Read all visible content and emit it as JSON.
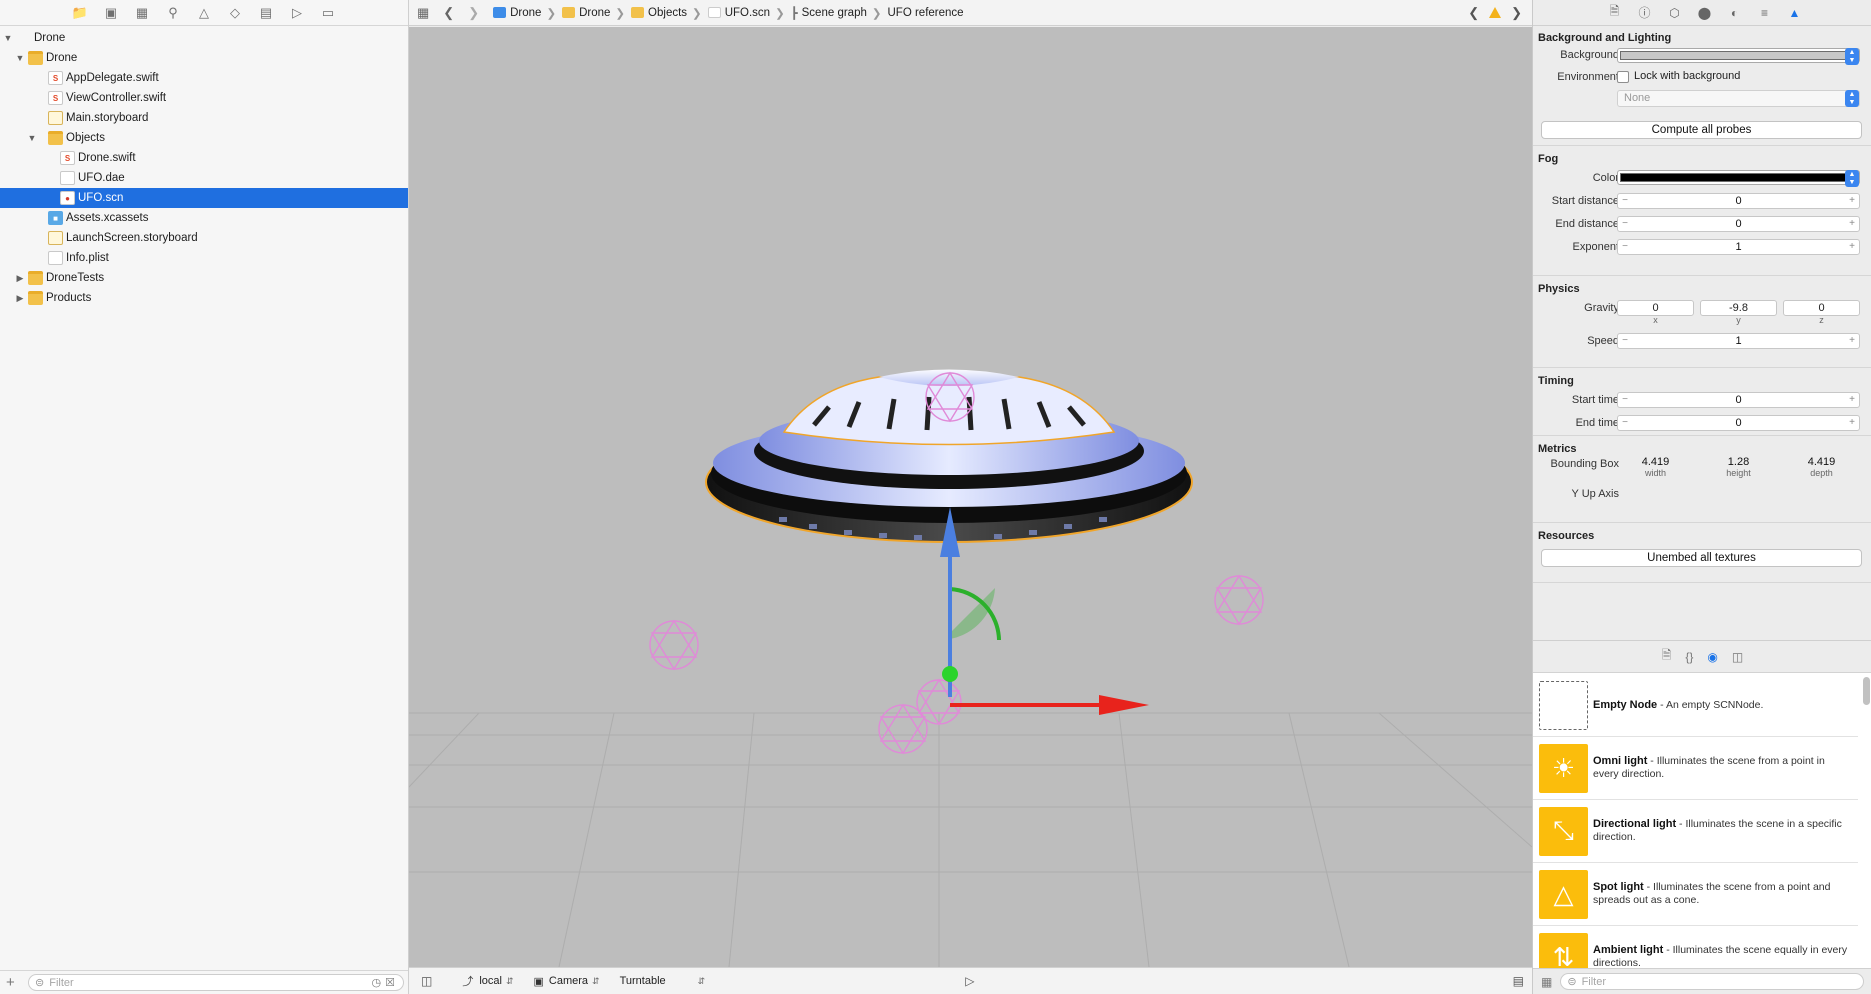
{
  "navigator": {
    "toolbar_icons": [
      "folder-icon",
      "source-control-icon",
      "symbol-icon",
      "search-icon",
      "issue-icon",
      "test-icon",
      "debug-icon",
      "breakpoint-icon",
      "report-icon"
    ],
    "tree": [
      {
        "label": "Drone",
        "icon": "project",
        "depth": 0,
        "disclosure": "open"
      },
      {
        "label": "Drone",
        "icon": "folder",
        "depth": 1,
        "disclosure": "open"
      },
      {
        "label": "AppDelegate.swift",
        "icon": "swift",
        "depth": 2,
        "disclosure": ""
      },
      {
        "label": "ViewController.swift",
        "icon": "swift",
        "depth": 2,
        "disclosure": ""
      },
      {
        "label": "Main.storyboard",
        "icon": "sb",
        "depth": 2,
        "disclosure": ""
      },
      {
        "label": "Objects",
        "icon": "folder",
        "depth": 2,
        "disclosure": "open"
      },
      {
        "label": "Drone.swift",
        "icon": "swift",
        "depth": 3,
        "disclosure": ""
      },
      {
        "label": "UFO.dae",
        "icon": "dae",
        "depth": 3,
        "disclosure": ""
      },
      {
        "label": "UFO.scn",
        "icon": "scn",
        "depth": 3,
        "disclosure": "",
        "selected": true
      },
      {
        "label": "Assets.xcassets",
        "icon": "assets",
        "depth": 2,
        "disclosure": ""
      },
      {
        "label": "LaunchScreen.storyboard",
        "icon": "sb",
        "depth": 2,
        "disclosure": ""
      },
      {
        "label": "Info.plist",
        "icon": "plist",
        "depth": 2,
        "disclosure": ""
      },
      {
        "label": "DroneTests",
        "icon": "folder",
        "depth": 1,
        "disclosure": "closed"
      },
      {
        "label": "Products",
        "icon": "folder",
        "depth": 1,
        "disclosure": "closed"
      }
    ],
    "filter_placeholder": "Filter"
  },
  "jumpbar": {
    "crumbs": [
      "Drone",
      "Drone",
      "Objects",
      "UFO.scn",
      "Scene graph",
      "UFO reference"
    ]
  },
  "editor_bottom": {
    "coordinate_space": "local",
    "camera": "Camera",
    "navigation_mode": "Turntable"
  },
  "inspector": {
    "background_lighting": {
      "title": "Background and Lighting",
      "background_label": "Background",
      "environment_label": "Environment",
      "lock_label": "Lock with background",
      "environment_value": "None",
      "compute_button": "Compute all probes"
    },
    "fog": {
      "title": "Fog",
      "color_label": "Color",
      "start_label": "Start distance",
      "start_value": "0",
      "end_label": "End distance",
      "end_value": "0",
      "exponent_label": "Exponent",
      "exponent_value": "1"
    },
    "physics": {
      "title": "Physics",
      "gravity_label": "Gravity",
      "gravity": {
        "x": "0",
        "y": "-9.8",
        "z": "0"
      },
      "axis_labels": {
        "x": "x",
        "y": "y",
        "z": "z"
      },
      "speed_label": "Speed",
      "speed_value": "1"
    },
    "timing": {
      "title": "Timing",
      "start_label": "Start time",
      "start_value": "0",
      "end_label": "End time",
      "end_value": "0"
    },
    "metrics": {
      "title": "Metrics",
      "bbox_label": "Bounding Box",
      "width": "4.419",
      "height": "1.28",
      "depth": "4.419",
      "width_label": "width",
      "height_label": "height",
      "depth_label": "depth",
      "up_axis": "Y Up Axis"
    },
    "resources": {
      "title": "Resources",
      "unembed_button": "Unembed all textures"
    }
  },
  "library": {
    "items": [
      {
        "name": "Empty Node",
        "desc": " - An empty SCNNode.",
        "icon": "empty"
      },
      {
        "name": "Omni light",
        "desc": " - Illuminates the scene from a point in every direction.",
        "icon": "omni"
      },
      {
        "name": "Directional light",
        "desc": " - Illuminates the scene in a specific direction.",
        "icon": "directional"
      },
      {
        "name": "Spot light",
        "desc": " - Illuminates the scene from a point and spreads out as a cone.",
        "icon": "spot"
      },
      {
        "name": "Ambient light",
        "desc": " - Illuminates the scene equally in every directions.",
        "icon": "ambient"
      }
    ],
    "filter_placeholder": "Filter"
  },
  "colors": {
    "selection": "#1f6fe0",
    "accent": "#3b86f0",
    "viewport_bg": "#bdbdbd",
    "gizmo_x": "#e8231c",
    "gizmo_y": "#4b7fe0",
    "gizmo_z": "#2bb02b",
    "light_markers": "#e08ad8",
    "highlight_outline": "#f0a52a",
    "library_thumb": "#fbbd0c"
  }
}
